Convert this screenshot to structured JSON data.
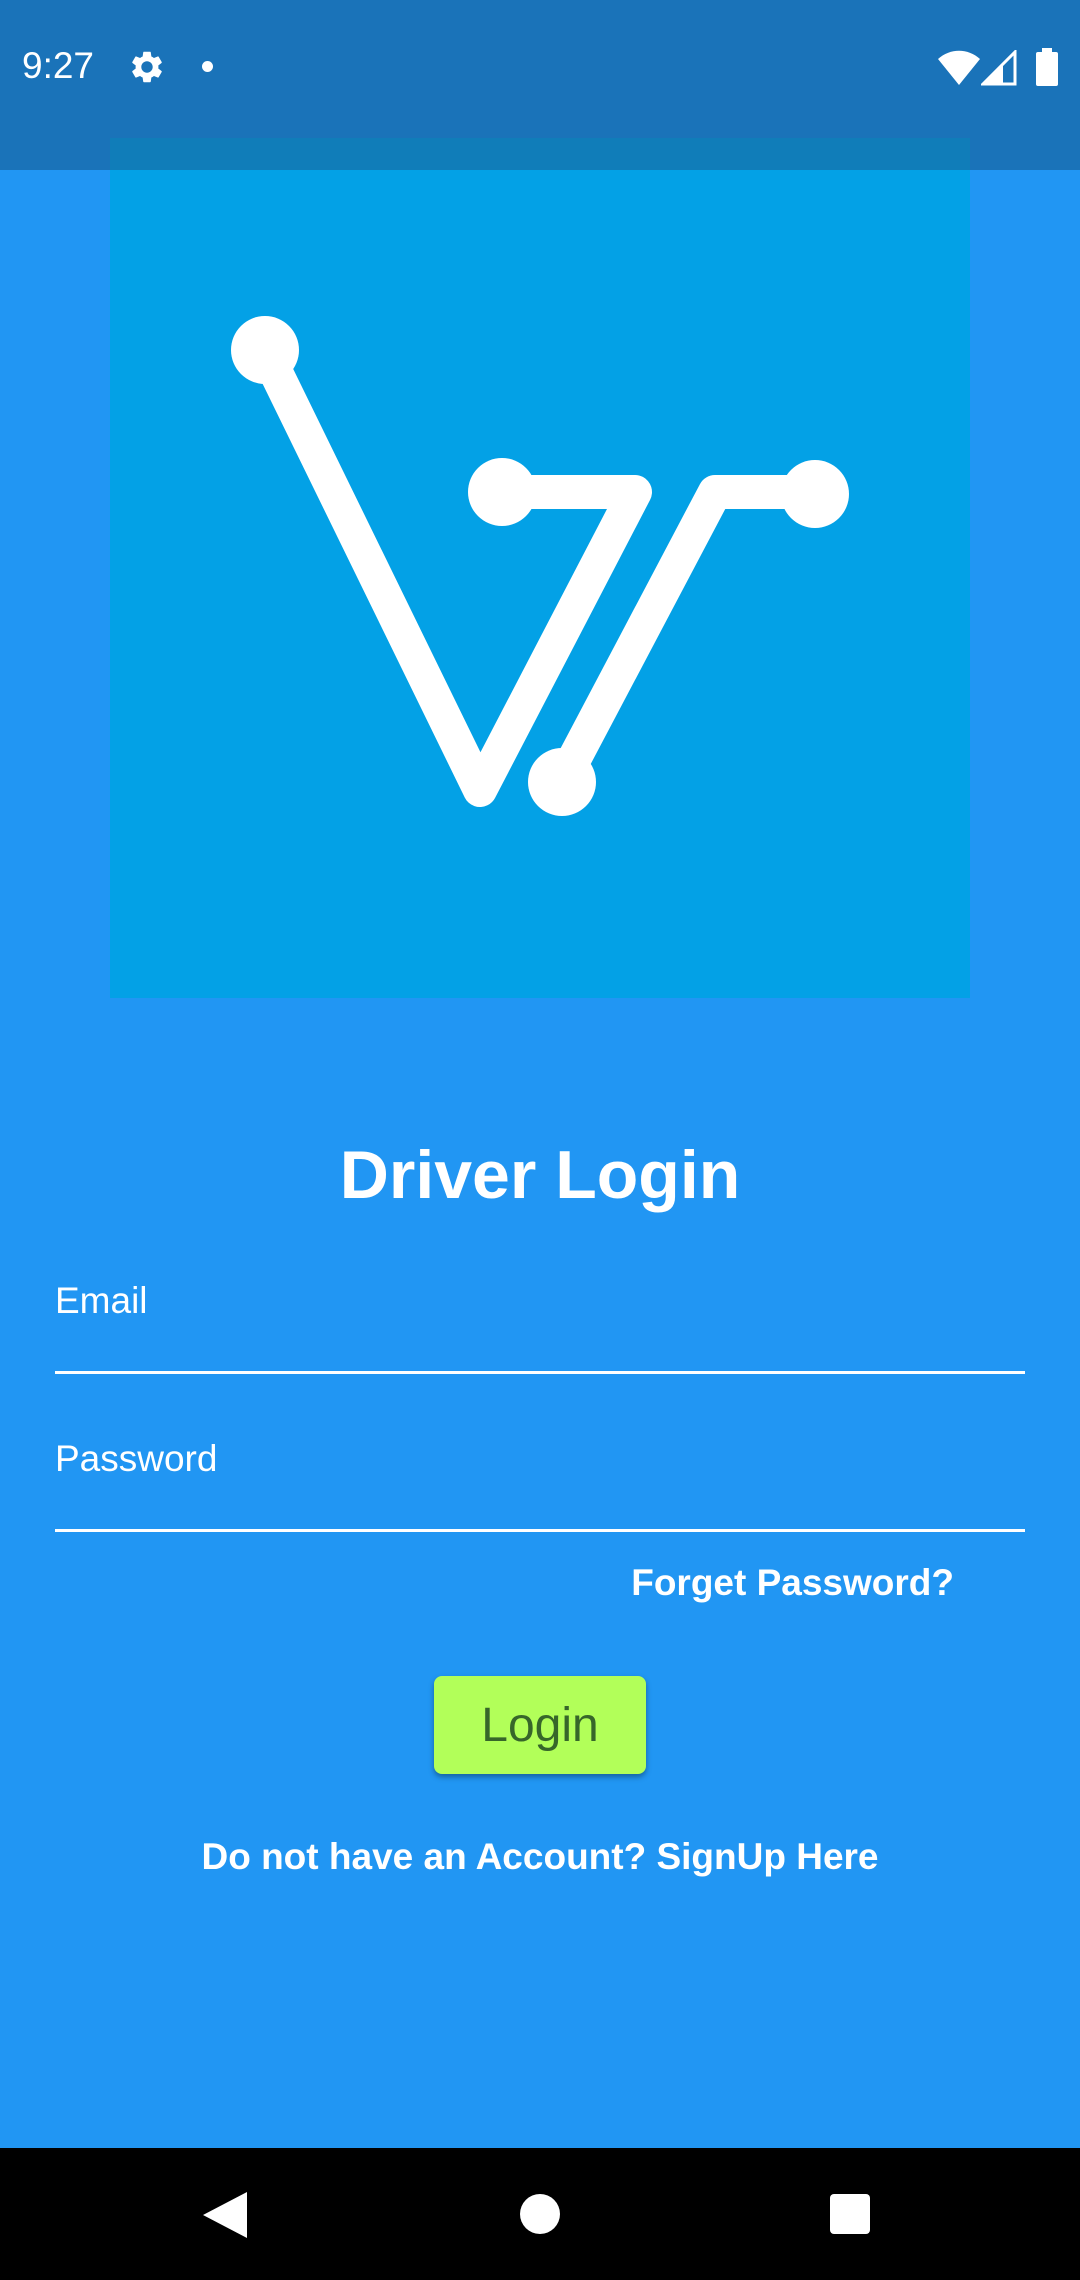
{
  "status_bar": {
    "time": "9:27",
    "icons": [
      "gear-icon",
      "notification-dot-icon",
      "wifi-icon",
      "signal-icon",
      "battery-icon"
    ]
  },
  "logo": {
    "icon": "driver-app-logo",
    "background_color": "#03a1e6",
    "mark_color": "#ffffff"
  },
  "login_form": {
    "title": "Driver Login",
    "email_placeholder": "Email",
    "email_value": "",
    "password_placeholder": "Password",
    "password_value": "",
    "forget_password": "Forget Password?",
    "login_label": "Login",
    "signup_text": "Do not have an Account? SignUp Here"
  },
  "navigation": {
    "icons": [
      "back-icon",
      "home-icon",
      "recents-icon"
    ]
  },
  "colors": {
    "background": "#2196f3",
    "status_bar": "#1a73b9",
    "login_button": "#b2ff59",
    "login_text": "#37662a"
  }
}
